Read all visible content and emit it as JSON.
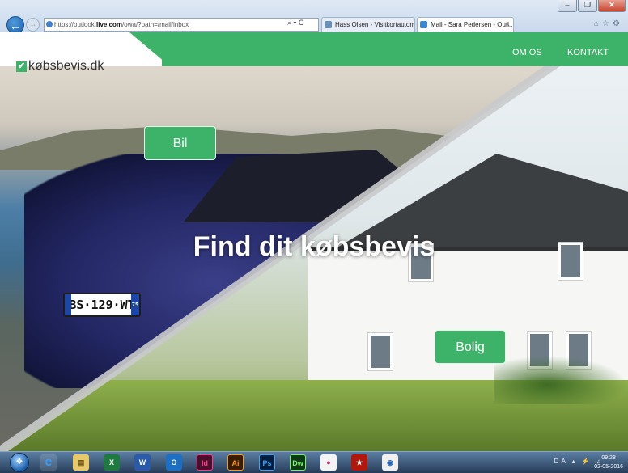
{
  "browser": {
    "url_prefix": "https://outlook.",
    "url_domain": "live.com",
    "url_suffix": "/owa/?path=/mail/inbox",
    "addr_tools": "⌕ ▾ C",
    "tabs": [
      {
        "label": "Hass Olsen - Visitkortautomat",
        "close": ""
      },
      {
        "label": "Mail - Sara Pedersen - Outl...",
        "close": "×"
      }
    ],
    "window_controls": [
      "–",
      "❐",
      "✕"
    ],
    "right_icons": "⌂☆⚙"
  },
  "site": {
    "logo_text": "købsbevis.dk",
    "logo_check": "✔",
    "nav": [
      "OM OS",
      "KONTAKT"
    ],
    "headline": "Find dit købsbevis",
    "btn_bil": "Bil",
    "btn_bolig": "Bolig",
    "plate_text": "BS·129·WT",
    "plate_dept": "75"
  },
  "taskbar": {
    "apps": [
      "e",
      "▤",
      "X",
      "W",
      "O",
      "Id",
      "Ai",
      "Ps",
      "Dw",
      "●",
      "★",
      "◉"
    ],
    "tray": "DA ▴ ⚡ ♫",
    "time": "09:28",
    "date": "02-05-2016"
  },
  "colors": {
    "accent": "#3db36a"
  }
}
